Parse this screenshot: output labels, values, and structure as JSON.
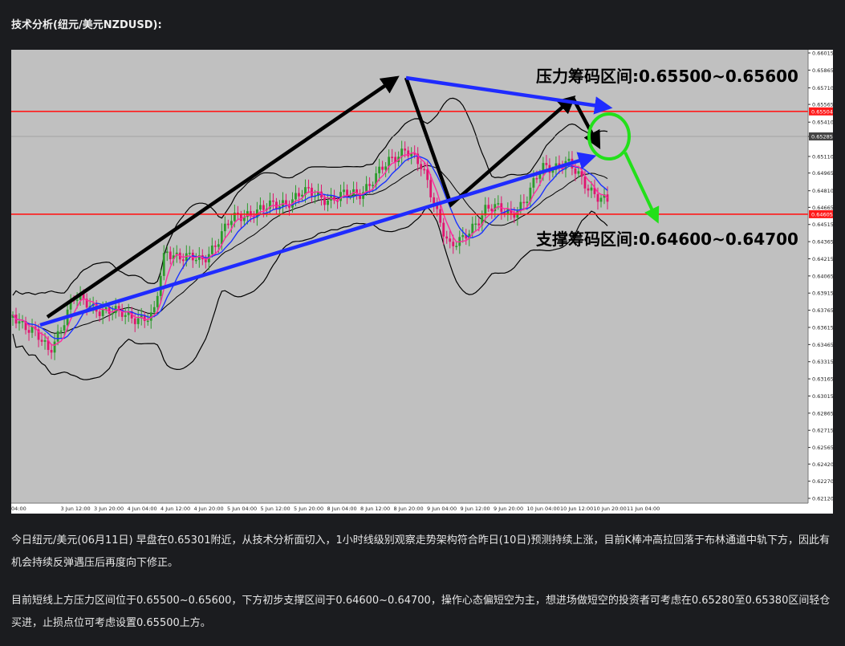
{
  "page": {
    "title": "技术分析(纽元/美元NZDUSD):",
    "paragraph1": "今日纽元/美元(06月11日) 早盘在0.65301附近，从技术分析面切入，1小时线级别观察走势架构符合昨日(10日)预测持续上涨，目前K棒冲高拉回落于布林通道中轨下方，因此有机会持续反弹遇压后再度向下修正。",
    "paragraph2": "目前短线上方压力区间位于0.65500~0.65600，下方初步支撑区间于0.64600~0.64700，操作心态偏短空为主，想进场做短空的投资者可考虑在0.65280至0.65380区间轻仓买进，止损点位可考虑设置0.65500上方。"
  },
  "colors": {
    "chart_bg": "#c0c0c0",
    "axis_bg": "#ffffff",
    "bull_candle": "#2c9b2c",
    "bear_candle": "#e0156f",
    "ma_blue": "#1a33ff",
    "ma_pink": "#ff2aa0",
    "bollinger": "#000000",
    "level_line": "#ff1a1a",
    "trend_black": "#000000",
    "trend_blue": "#1f2bff",
    "forecast_green": "#22e01a"
  },
  "chart_data": {
    "type": "candlestick",
    "instrument": "NZDUSD",
    "timeframe": "1 hour",
    "ylim": [
      0.6212,
      0.66015
    ],
    "y_ticks": [
      "0.66015",
      "0.65865",
      "0.65710",
      "0.65565",
      "0.65410",
      "0.65285",
      "0.65110",
      "0.64965",
      "0.64810",
      "0.64665",
      "0.64515",
      "0.64365",
      "0.64215",
      "0.64065",
      "0.63915",
      "0.63765",
      "0.63615",
      "0.63465",
      "0.63315",
      "0.63165",
      "0.63015",
      "0.62865",
      "0.62715",
      "0.62565",
      "0.62420",
      "0.62270",
      "0.62120"
    ],
    "x_ticks": [
      "2 Jun 04:00",
      "3 Jun 12:00",
      "3 Jun 20:00",
      "4 Jun 04:00",
      "4 Jun 12:00",
      "4 Jun 20:00",
      "5 Jun 04:00",
      "5 Jun 12:00",
      "5 Jun 20:00",
      "8 Jun 04:00",
      "8 Jun 12:00",
      "8 Jun 20:00",
      "9 Jun 04:00",
      "9 Jun 12:00",
      "9 Jun 20:00",
      "10 Jun 04:00",
      "10 Jun 12:00",
      "10 Jun 20:00",
      "11 Jun 04:00"
    ],
    "price_markers": [
      {
        "label": "0.65504",
        "value": 0.65504,
        "color": "#ff1a1a"
      },
      {
        "label": "0.65285",
        "value": 0.65285,
        "color": "#444444"
      },
      {
        "label": "0.64605",
        "value": 0.64605,
        "color": "#ff1a1a"
      }
    ],
    "horizontal_levels": [
      {
        "value": 0.65504,
        "color": "#ff1a1a"
      },
      {
        "value": 0.65285,
        "color": "#999999"
      },
      {
        "value": 0.64605,
        "color": "#ff1a1a"
      }
    ],
    "annotations": [
      {
        "text": "压力筹码区间:0.65500~0.65600",
        "value": 0.6582
      },
      {
        "text": "支撑筹码区间:0.64600~0.64700",
        "value": 0.64395
      }
    ]
  }
}
